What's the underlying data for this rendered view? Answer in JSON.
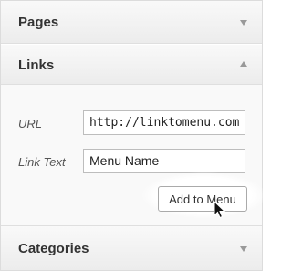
{
  "sections": {
    "pages": {
      "title": "Pages",
      "toggle_icon": "chevron-down-icon"
    },
    "links": {
      "title": "Links",
      "toggle_icon": "chevron-up-icon"
    },
    "categories": {
      "title": "Categories",
      "toggle_icon": "chevron-down-icon"
    }
  },
  "links_form": {
    "url_label": "URL",
    "url_value": "http://linktomenu.com",
    "link_text_label": "Link Text",
    "link_text_value": "Menu Name",
    "add_button_label": "Add to Menu"
  },
  "cursor": {
    "icon": "mouse-pointer-icon"
  },
  "colors": {
    "panel_bg": "#f9f9f9",
    "border": "#dfdfdf",
    "arrow": "#999999",
    "input_border": "#bdbdbd"
  }
}
